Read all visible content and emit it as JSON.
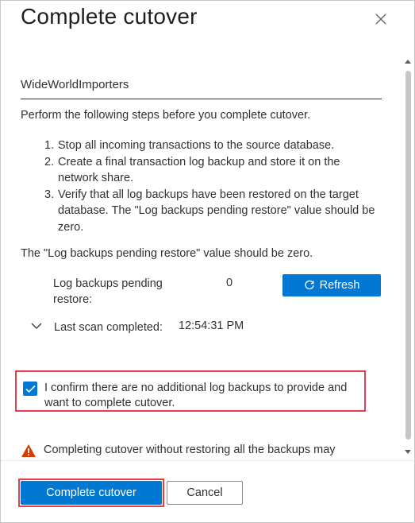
{
  "dialog": {
    "title": "Complete cutover"
  },
  "content": {
    "database_name": "WideWorldImporters",
    "intro": "Perform the following steps before you complete cutover.",
    "steps": [
      {
        "number": "1.",
        "text": "Stop all incoming transactions to the source database."
      },
      {
        "number": "2.",
        "text": "Create a final transaction log backup and store it on the network share."
      },
      {
        "number": "3.",
        "text": "Verify that all log backups have been restored on the target database. The \"Log backups pending restore\" value should be zero."
      }
    ],
    "note": "The \"Log backups pending restore\" value should be zero.",
    "pending_label": "Log backups pending restore:",
    "pending_value": "0",
    "refresh_label": "Refresh",
    "scan_label": "Last scan completed:",
    "scan_value": "12:54:31 PM",
    "confirm_checked": true,
    "confirm_text": "I confirm there are no additional log backups to provide and want to complete cutover.",
    "warning_text": "Completing cutover without restoring all the backups may"
  },
  "footer": {
    "complete_label": "Complete cutover",
    "cancel_label": "Cancel"
  },
  "icons": {
    "close": "close-icon",
    "refresh": "refresh-icon",
    "chevron": "chevron-down-icon",
    "check": "checkmark-icon",
    "warning": "warning-icon"
  },
  "colors": {
    "accent": "#0078d4",
    "highlight_border": "#e3404d",
    "warning": "#d83b01"
  }
}
